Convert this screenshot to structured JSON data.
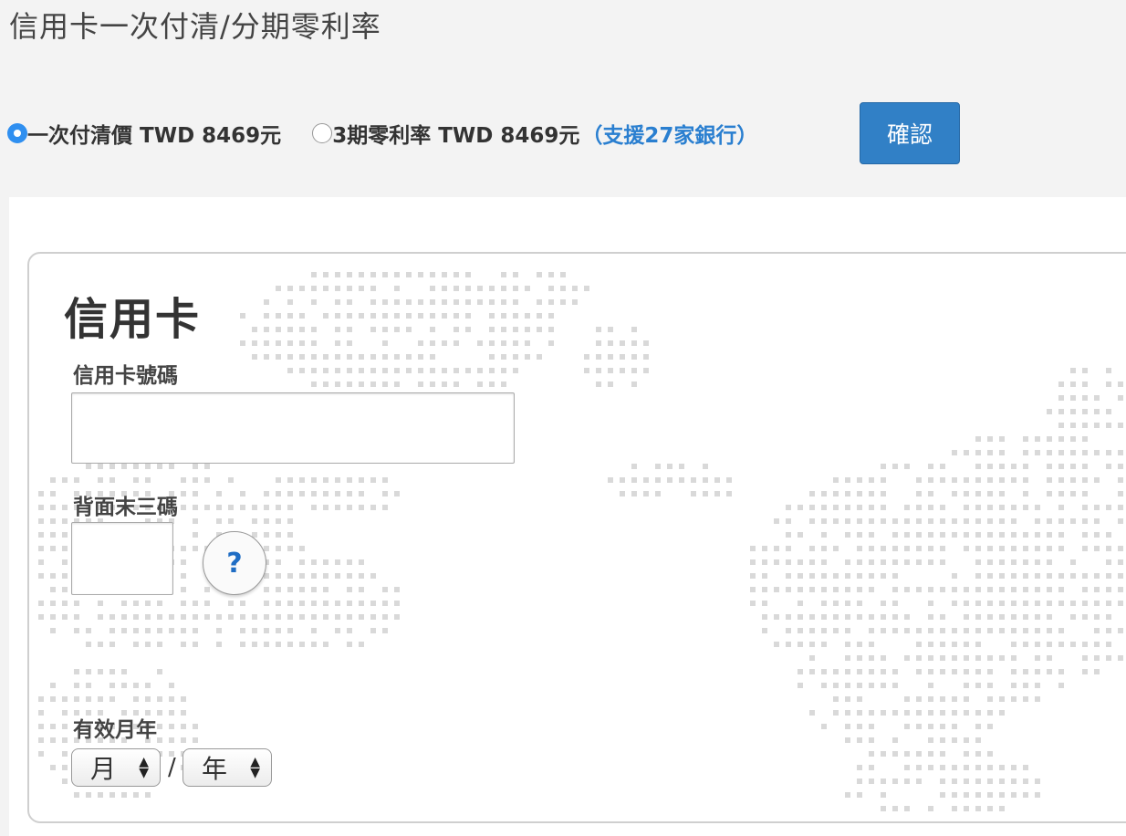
{
  "page": {
    "title": "信用卡一次付清/分期零利率"
  },
  "payment_options": {
    "option1_label": "一次付清價 TWD 8469元",
    "option2_label": "3期零利率 TWD 8469元",
    "option2_note": "（支援27家銀行）",
    "confirm_label": "確認"
  },
  "card_form": {
    "title": "信用卡",
    "card_number_label": "信用卡號碼",
    "card_number_value": "",
    "cvv_label": "背面末三碼",
    "cvv_value": "",
    "help_label": "?",
    "expiry_label": "有效月年",
    "month_selected": "月",
    "date_separator": "/",
    "year_selected": "年"
  },
  "colors": {
    "accent": "#3180c6",
    "link": "#2a7fd0",
    "radio_checked": "#2f8ff0"
  },
  "icons": {
    "radio_checked": "radio-checked-icon",
    "radio_unchecked": "radio-unchecked-icon",
    "help": "question-mark-icon",
    "select_arrows": "updown-arrows-icon",
    "background": "world-map-dots"
  }
}
